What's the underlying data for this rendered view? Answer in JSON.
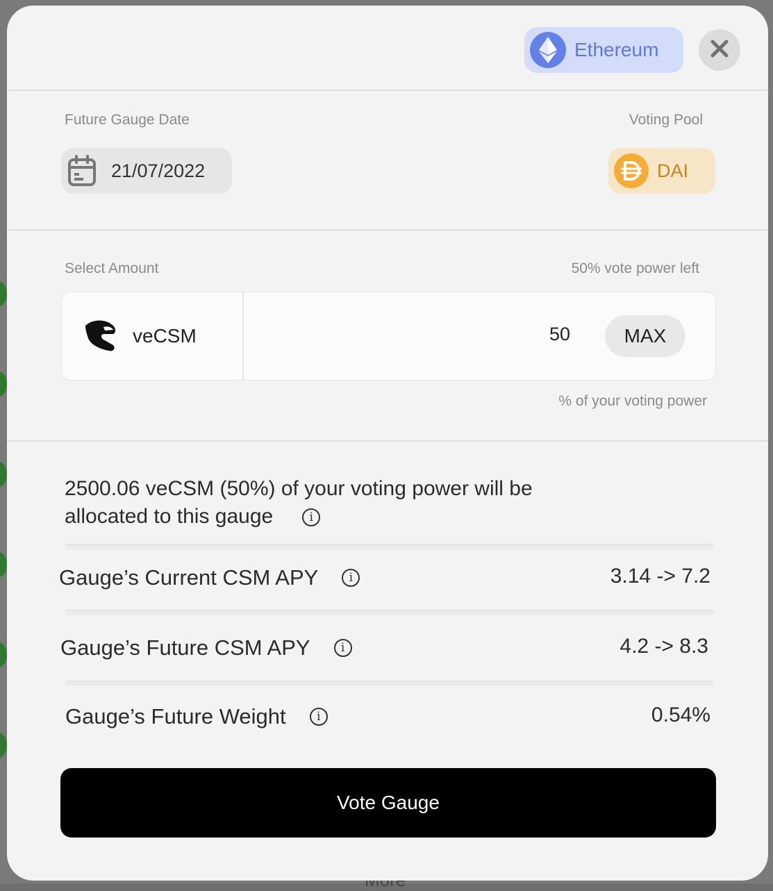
{
  "header": {
    "network_label": "Ethereum",
    "network_icon": "ethereum-icon",
    "close_icon": "close-icon"
  },
  "gauge": {
    "date_label": "Future Gauge Date",
    "date_value": "21/07/2022",
    "pool_label": "Voting Pool",
    "pool_token": "DAI"
  },
  "amount": {
    "label": "Select Amount",
    "power_left": "50% vote power left",
    "token_label": "veCSM",
    "value": "50",
    "max_label": "MAX",
    "hint": "% of your voting power"
  },
  "summary": {
    "line1": "2500.06 veCSM (50%) of your voting power will be",
    "line2": "allocated to this gauge"
  },
  "stats": [
    {
      "label": "Gauge’s Current CSM APY",
      "value": "3.14 -> 7.2"
    },
    {
      "label": "Gauge’s Future CSM APY",
      "value": "4.2 -> 8.3"
    },
    {
      "label": "Gauge’s Future Weight",
      "value": "0.54%"
    }
  ],
  "vote_button_label": "Vote Gauge",
  "colors": {
    "ethereum_pill": "#d3dcfb",
    "ethereum_accent": "#6481e8",
    "dai_pill": "#f6e5c6",
    "dai_accent": "#f5ac37",
    "primary_button": "#000000"
  },
  "background": {
    "partial_text": "More"
  }
}
